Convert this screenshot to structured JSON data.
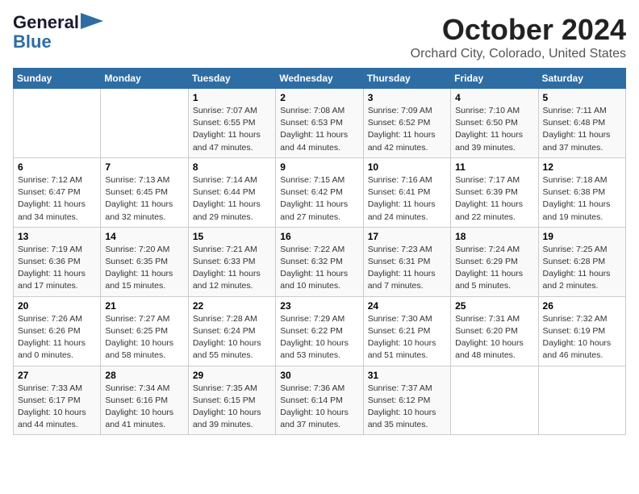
{
  "logo": {
    "line1": "General",
    "line2": "Blue"
  },
  "title": "October 2024",
  "location": "Orchard City, Colorado, United States",
  "headers": [
    "Sunday",
    "Monday",
    "Tuesday",
    "Wednesday",
    "Thursday",
    "Friday",
    "Saturday"
  ],
  "weeks": [
    [
      {
        "day": "",
        "info": ""
      },
      {
        "day": "",
        "info": ""
      },
      {
        "day": "1",
        "info": "Sunrise: 7:07 AM\nSunset: 6:55 PM\nDaylight: 11 hours and 47 minutes."
      },
      {
        "day": "2",
        "info": "Sunrise: 7:08 AM\nSunset: 6:53 PM\nDaylight: 11 hours and 44 minutes."
      },
      {
        "day": "3",
        "info": "Sunrise: 7:09 AM\nSunset: 6:52 PM\nDaylight: 11 hours and 42 minutes."
      },
      {
        "day": "4",
        "info": "Sunrise: 7:10 AM\nSunset: 6:50 PM\nDaylight: 11 hours and 39 minutes."
      },
      {
        "day": "5",
        "info": "Sunrise: 7:11 AM\nSunset: 6:48 PM\nDaylight: 11 hours and 37 minutes."
      }
    ],
    [
      {
        "day": "6",
        "info": "Sunrise: 7:12 AM\nSunset: 6:47 PM\nDaylight: 11 hours and 34 minutes."
      },
      {
        "day": "7",
        "info": "Sunrise: 7:13 AM\nSunset: 6:45 PM\nDaylight: 11 hours and 32 minutes."
      },
      {
        "day": "8",
        "info": "Sunrise: 7:14 AM\nSunset: 6:44 PM\nDaylight: 11 hours and 29 minutes."
      },
      {
        "day": "9",
        "info": "Sunrise: 7:15 AM\nSunset: 6:42 PM\nDaylight: 11 hours and 27 minutes."
      },
      {
        "day": "10",
        "info": "Sunrise: 7:16 AM\nSunset: 6:41 PM\nDaylight: 11 hours and 24 minutes."
      },
      {
        "day": "11",
        "info": "Sunrise: 7:17 AM\nSunset: 6:39 PM\nDaylight: 11 hours and 22 minutes."
      },
      {
        "day": "12",
        "info": "Sunrise: 7:18 AM\nSunset: 6:38 PM\nDaylight: 11 hours and 19 minutes."
      }
    ],
    [
      {
        "day": "13",
        "info": "Sunrise: 7:19 AM\nSunset: 6:36 PM\nDaylight: 11 hours and 17 minutes."
      },
      {
        "day": "14",
        "info": "Sunrise: 7:20 AM\nSunset: 6:35 PM\nDaylight: 11 hours and 15 minutes."
      },
      {
        "day": "15",
        "info": "Sunrise: 7:21 AM\nSunset: 6:33 PM\nDaylight: 11 hours and 12 minutes."
      },
      {
        "day": "16",
        "info": "Sunrise: 7:22 AM\nSunset: 6:32 PM\nDaylight: 11 hours and 10 minutes."
      },
      {
        "day": "17",
        "info": "Sunrise: 7:23 AM\nSunset: 6:31 PM\nDaylight: 11 hours and 7 minutes."
      },
      {
        "day": "18",
        "info": "Sunrise: 7:24 AM\nSunset: 6:29 PM\nDaylight: 11 hours and 5 minutes."
      },
      {
        "day": "19",
        "info": "Sunrise: 7:25 AM\nSunset: 6:28 PM\nDaylight: 11 hours and 2 minutes."
      }
    ],
    [
      {
        "day": "20",
        "info": "Sunrise: 7:26 AM\nSunset: 6:26 PM\nDaylight: 11 hours and 0 minutes."
      },
      {
        "day": "21",
        "info": "Sunrise: 7:27 AM\nSunset: 6:25 PM\nDaylight: 10 hours and 58 minutes."
      },
      {
        "day": "22",
        "info": "Sunrise: 7:28 AM\nSunset: 6:24 PM\nDaylight: 10 hours and 55 minutes."
      },
      {
        "day": "23",
        "info": "Sunrise: 7:29 AM\nSunset: 6:22 PM\nDaylight: 10 hours and 53 minutes."
      },
      {
        "day": "24",
        "info": "Sunrise: 7:30 AM\nSunset: 6:21 PM\nDaylight: 10 hours and 51 minutes."
      },
      {
        "day": "25",
        "info": "Sunrise: 7:31 AM\nSunset: 6:20 PM\nDaylight: 10 hours and 48 minutes."
      },
      {
        "day": "26",
        "info": "Sunrise: 7:32 AM\nSunset: 6:19 PM\nDaylight: 10 hours and 46 minutes."
      }
    ],
    [
      {
        "day": "27",
        "info": "Sunrise: 7:33 AM\nSunset: 6:17 PM\nDaylight: 10 hours and 44 minutes."
      },
      {
        "day": "28",
        "info": "Sunrise: 7:34 AM\nSunset: 6:16 PM\nDaylight: 10 hours and 41 minutes."
      },
      {
        "day": "29",
        "info": "Sunrise: 7:35 AM\nSunset: 6:15 PM\nDaylight: 10 hours and 39 minutes."
      },
      {
        "day": "30",
        "info": "Sunrise: 7:36 AM\nSunset: 6:14 PM\nDaylight: 10 hours and 37 minutes."
      },
      {
        "day": "31",
        "info": "Sunrise: 7:37 AM\nSunset: 6:12 PM\nDaylight: 10 hours and 35 minutes."
      },
      {
        "day": "",
        "info": ""
      },
      {
        "day": "",
        "info": ""
      }
    ]
  ]
}
